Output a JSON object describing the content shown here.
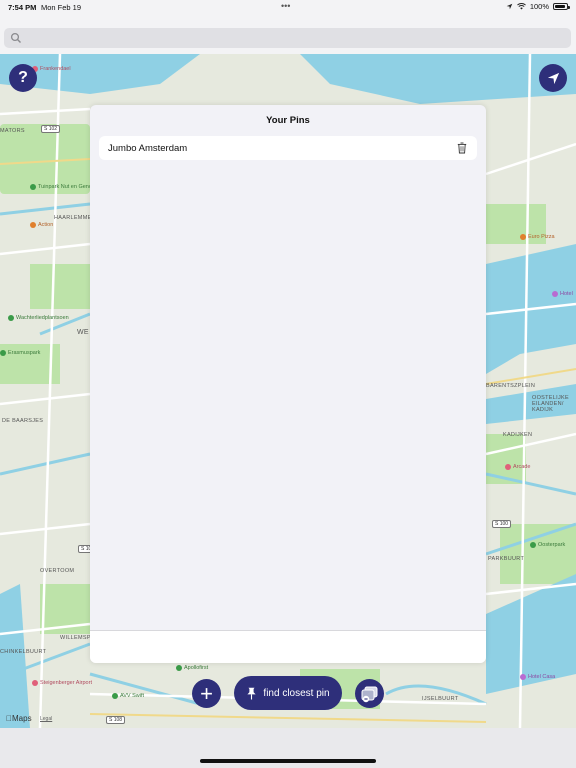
{
  "status_bar": {
    "time": "7:54 PM",
    "date": "Mon Feb 19",
    "battery": "100%"
  },
  "search": {
    "placeholder": "",
    "value": ""
  },
  "map": {
    "districts": [
      "WE",
      "DE BAARSJES",
      "WILLEMSP",
      "CHINKELBUURT",
      "OVERTOOM",
      "HAARLEMMER",
      "KADIJKEN",
      "OOSTELIJKE EILANDEN/ KADIJK",
      "PARKBUURT",
      "IJSELBUURT",
      "BARENTSZPLEIN",
      "MATORS"
    ],
    "pois": [
      {
        "name": "Tuinpark Nut en Genoegen",
        "color": "#3a9b48"
      },
      {
        "name": "Action",
        "color": "#e0802d"
      },
      {
        "name": "Wachterliedplantsoen",
        "color": "#3a9b48"
      },
      {
        "name": "Erasmuspark",
        "color": "#3a9b48"
      },
      {
        "name": "Euro Pizza",
        "color": "#e0802d"
      },
      {
        "name": "Hotel",
        "color": "#b86cd1"
      },
      {
        "name": "Arcade",
        "color": "#e0607a"
      },
      {
        "name": "Oosterpark",
        "color": "#3a9b48"
      },
      {
        "name": "Hotel Casa",
        "color": "#b86cd1"
      },
      {
        "name": "Apollofirst",
        "color": "#3a9b48"
      },
      {
        "name": "Steigenberger Airport",
        "color": "#e0607a"
      },
      {
        "name": "AVV Swift",
        "color": "#3a9b48"
      },
      {
        "name": "Frankendael",
        "color": "#e0607a"
      }
    ],
    "roads": [
      "S 102",
      "S 100",
      "S 108",
      "S 106"
    ],
    "maps_logo": "Maps",
    "legal": "Legal"
  },
  "sheet": {
    "title": "Your Pins",
    "pins": [
      {
        "name": "Jumbo Amsterdam"
      }
    ]
  },
  "controls": {
    "help": "?",
    "add": "+",
    "find_closest": "find closest pin"
  },
  "colors": {
    "accent": "#2e2f7a",
    "water": "#8fd0e4",
    "park": "#bde3a9"
  }
}
